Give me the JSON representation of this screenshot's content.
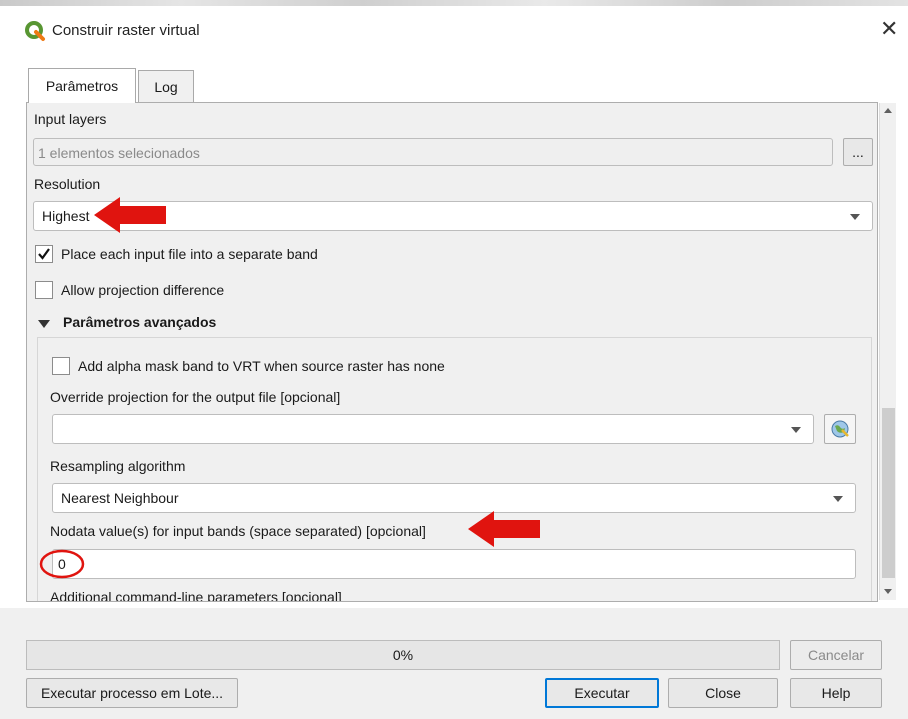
{
  "window": {
    "title": "Construir raster virtual",
    "close_glyph": "✕"
  },
  "tabs": [
    {
      "label": "Parâmetros",
      "active": true
    },
    {
      "label": "Log",
      "active": false
    }
  ],
  "params": {
    "input_layers": {
      "label": "Input layers",
      "value": "1 elementos selecionados",
      "browse_label": "..."
    },
    "resolution": {
      "label": "Resolution",
      "value": "Highest"
    },
    "separate_band": {
      "label": "Place each input file into a separate band",
      "checked": true
    },
    "allow_projection": {
      "label": "Allow projection difference",
      "checked": false
    },
    "advanced": {
      "header": "Parâmetros avançados",
      "alpha_mask": {
        "label": "Add alpha mask band to VRT when source raster has none",
        "checked": false
      },
      "override_projection": {
        "label": "Override projection for the output file [opcional]",
        "value": ""
      },
      "resampling": {
        "label": "Resampling algorithm",
        "value": "Nearest Neighbour"
      },
      "nodata": {
        "label": "Nodata value(s) for input bands (space separated) [opcional]",
        "value": "0"
      },
      "additional": {
        "label": "Additional command-line parameters [opcional]"
      }
    }
  },
  "progress": {
    "text": "0%",
    "value": 0
  },
  "buttons": {
    "cancel": "Cancelar",
    "batch": "Executar processo em Lote...",
    "run": "Executar",
    "close": "Close",
    "help": "Help"
  },
  "icons": [
    "qgis-logo-icon",
    "close-icon",
    "chevron-down-icon",
    "triangle-down-icon",
    "globe-icon",
    "scroll-up-icon",
    "scroll-down-icon"
  ],
  "colors": {
    "annotation_red": "#e0140f",
    "accent_blue": "#0078d7"
  }
}
